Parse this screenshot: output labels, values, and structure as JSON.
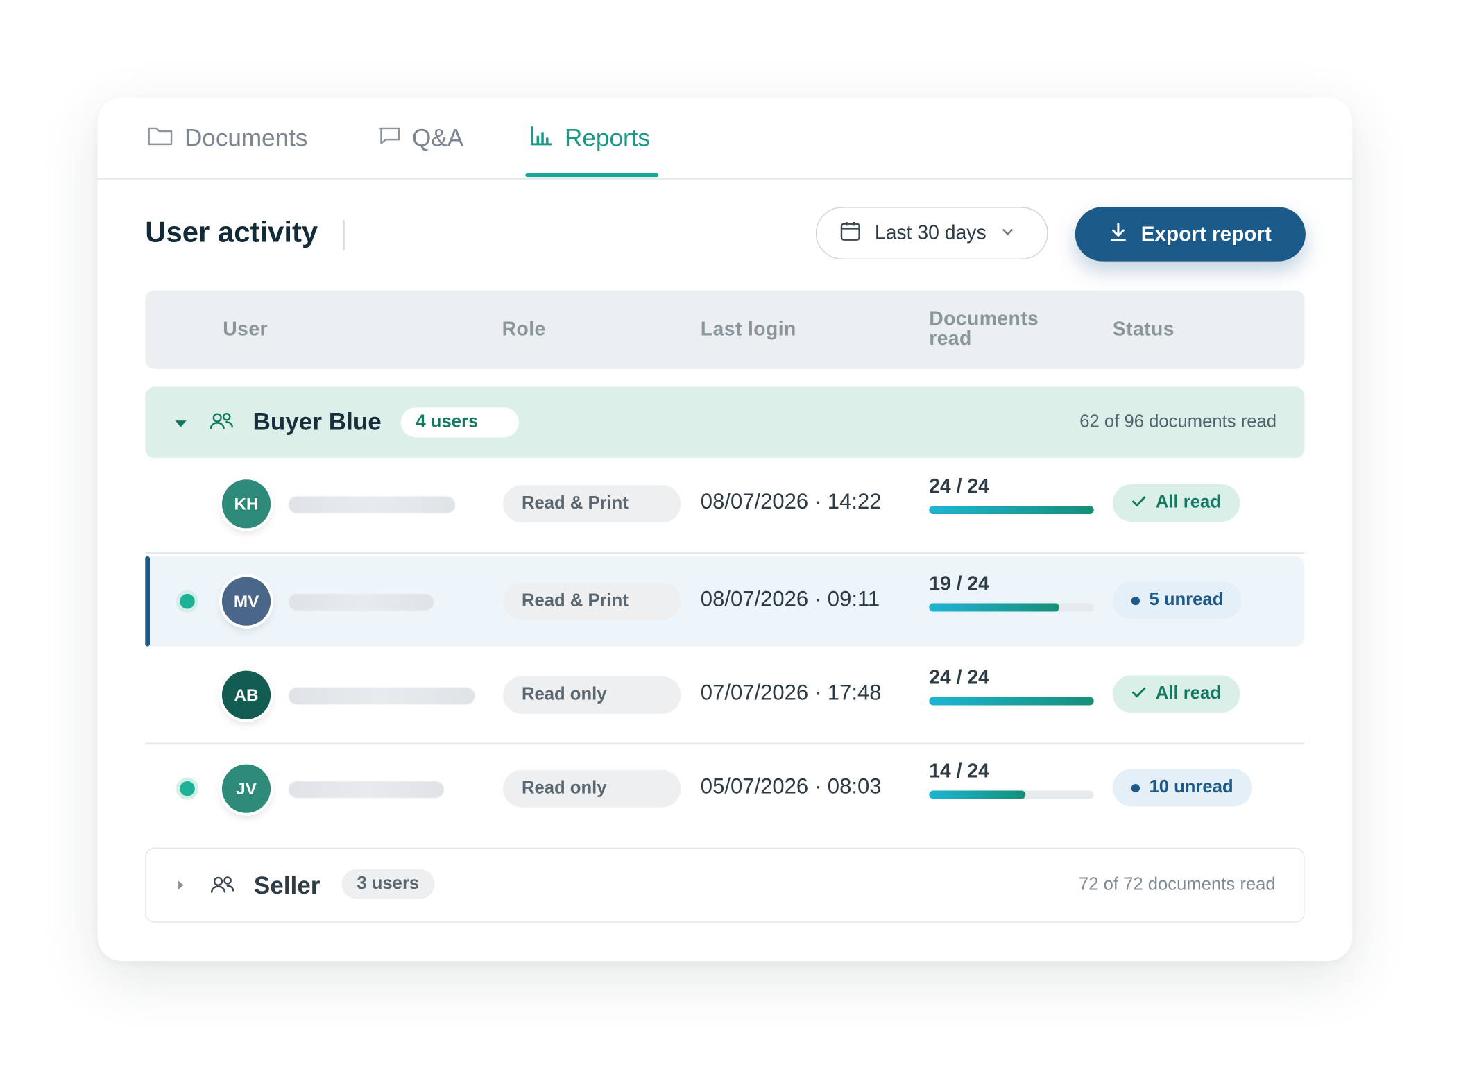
{
  "tabs": [
    {
      "label": "Documents",
      "icon": "folder-icon",
      "active": false
    },
    {
      "label": "Q&A",
      "icon": "chat-icon",
      "active": false
    },
    {
      "label": "Reports",
      "icon": "bar-chart-icon",
      "active": true
    }
  ],
  "header": {
    "title": "User activity",
    "date_range": "Last 30 days",
    "export_label": "Export report"
  },
  "table": {
    "columns": [
      "User",
      "Role",
      "Last login",
      "Documents read",
      "Status"
    ],
    "columns_display": {
      "user": "User",
      "role": "Role",
      "last_login": "Last login",
      "docs_line1": "Documents",
      "docs_line2": "read",
      "status": "Status"
    }
  },
  "groups": [
    {
      "name": "Buyer Blue",
      "count_label": "4 users",
      "summary": "62 of 96 documents read",
      "expanded": true,
      "rows": [
        {
          "initials": "KH",
          "avatar_color": "#2e8b7a",
          "online": false,
          "role": "Read & Print",
          "last_login": "08/07/2026 · 14:22",
          "docs": "24 / 24",
          "docs_read": 24,
          "docs_total": 24,
          "status": "All read",
          "status_type": "ok",
          "selected": false
        },
        {
          "initials": "MV",
          "avatar_color": "#4a6688",
          "online": true,
          "role": "Read & Print",
          "last_login": "08/07/2026 · 09:11",
          "docs": "19 / 24",
          "docs_read": 19,
          "docs_total": 24,
          "status": "5 unread",
          "status_type": "unread",
          "selected": true
        },
        {
          "initials": "AB",
          "avatar_color": "#135c52",
          "online": false,
          "role": "Read only",
          "last_login": "07/07/2026 · 17:48",
          "docs": "24 / 24",
          "docs_read": 24,
          "docs_total": 24,
          "status": "All read",
          "status_type": "ok",
          "selected": false
        },
        {
          "initials": "JV",
          "avatar_color": "#2e8b7a",
          "online": true,
          "role": "Read only",
          "last_login": "05/07/2026 · 08:03",
          "docs": "14 / 24",
          "docs_read": 14,
          "docs_total": 24,
          "status": "10 unread",
          "status_type": "unread",
          "selected": false
        }
      ]
    },
    {
      "name": "Seller",
      "count_label": "3 users",
      "summary": "72 of 72 documents read",
      "expanded": false
    }
  ],
  "colors": {
    "accent": "#1a9a86",
    "primary": "#1c5a8a",
    "group_bg": "#dcefe9"
  }
}
